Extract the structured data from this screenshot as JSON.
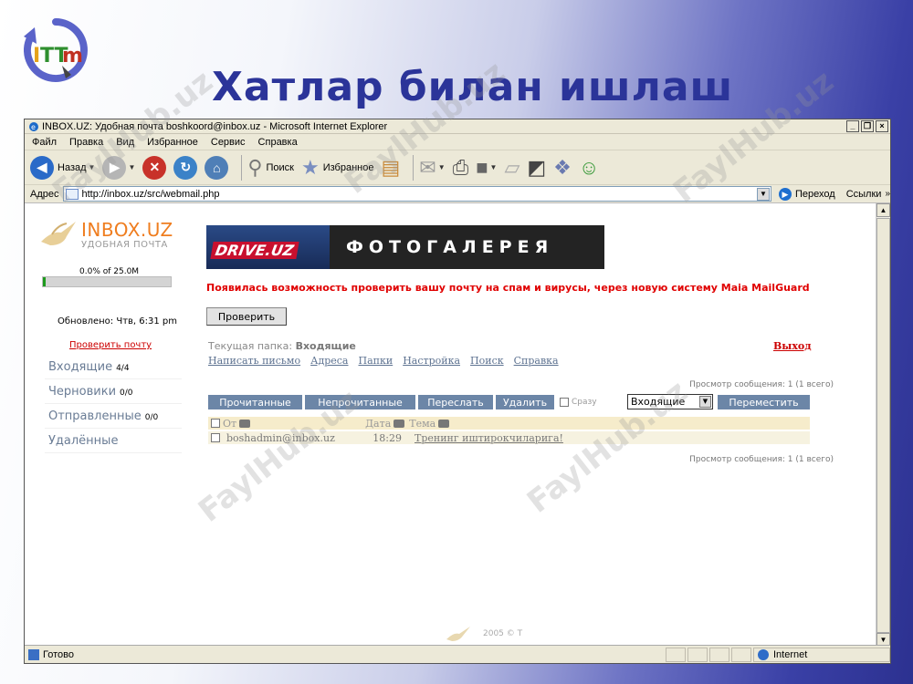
{
  "slide": {
    "title": "Хатлар билан ишлаш",
    "logo_letters": "ITTm",
    "watermark": "FaylHub.uz"
  },
  "browser": {
    "window_title": "INBOX.UZ: Удобная почта boshkoord@inbox.uz - Microsoft Internet Explorer",
    "menu": [
      "Файл",
      "Правка",
      "Вид",
      "Избранное",
      "Сервис",
      "Справка"
    ],
    "toolbar": {
      "back": "Назад",
      "search": "Поиск",
      "favorites": "Избранное"
    },
    "address_label": "Адрес",
    "url": "http://inbox.uz/src/webmail.php",
    "go": "Переход",
    "links": "Ссылки",
    "status": "Готово",
    "zone": "Internet"
  },
  "webmail": {
    "logo": "INBOX.UZ",
    "logo_sub": "УДОБНАЯ ПОЧТА",
    "quota_text": "0.0% of 25.0M",
    "quota_fraction": 0.01,
    "updated": "Обновлено: Чтв, 6:31 pm",
    "check_mail_link": "Проверить почту",
    "folders": [
      {
        "name": "Входящие",
        "count": "4/4"
      },
      {
        "name": "Черновики",
        "count": "0/0"
      },
      {
        "name": "Отправленные",
        "count": "0/0"
      },
      {
        "name": "Удалённые",
        "count": ""
      }
    ],
    "banner_brand": "DRIVE.UZ",
    "banner_title": "ФОТОГАЛЕРЕЯ",
    "notice": "Появилась возможность проверить вашу почту на спам и вирусы, через новую систему Maia MailGuard",
    "check_button": "Проверить",
    "current_folder_label": "Текущая папка:",
    "current_folder": "Входящие",
    "logout": "Выход",
    "nav": [
      "Написать письмо",
      "Адреса",
      "Папки",
      "Настройка",
      "Поиск",
      "Справка"
    ],
    "view_info": "Просмотр сообщения: 1 (1 всего)",
    "actions": [
      "Прочитанные",
      "Непрочитанные",
      "Переслать",
      "Удалить"
    ],
    "instant_label": "Сразу",
    "move_target": "Входящие",
    "move_button": "Переместить",
    "columns": {
      "from": "От",
      "date": "Дата",
      "subject": "Тема"
    },
    "messages": [
      {
        "from": "boshadmin@inbox.uz",
        "date": "18:29",
        "subject": "Тренинг иштирокчиларига!"
      }
    ],
    "footer": "2005 © Т"
  },
  "colors": {
    "title": "#2b3499",
    "logo_orange": "#ef7d1f",
    "action_button": "#6c86a7",
    "notice_red": "#e00000"
  }
}
